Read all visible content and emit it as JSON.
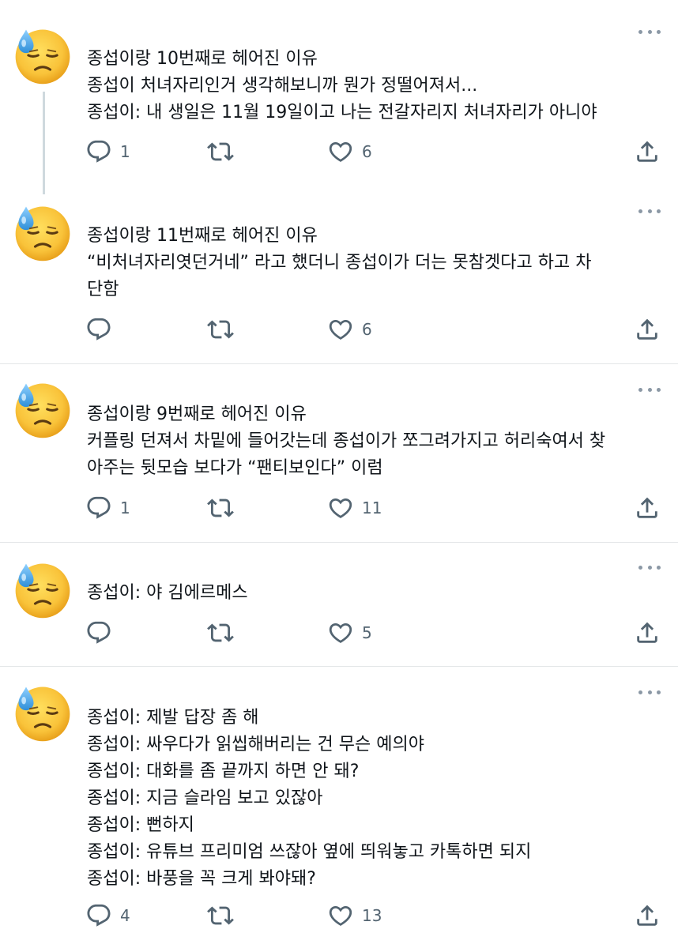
{
  "posts": [
    {
      "lines": [
        "종섭이랑 10번째로 헤어진 이유",
        "종섭이 처녀자리인거 생각해보니까 뭔가 정떨어져서...",
        "종섭이: 내 생일은 11월 19일이고 나는 전갈자리지 처녀자리가 아니야"
      ],
      "reply_count": "1",
      "retweet_count": "",
      "like_count": "6"
    },
    {
      "lines": [
        "종섭이랑 11번째로 헤어진 이유",
        "“비처녀자리엿던거네” 라고 했더니 종섭이가 더는 못참겟다고 하고 차",
        "단함"
      ],
      "reply_count": "",
      "retweet_count": "",
      "like_count": "6"
    },
    {
      "lines": [
        "종섭이랑 9번째로 헤어진 이유",
        "커플링 던져서 차밑에 들어갓는데 종섭이가 쪼그려가지고 허리숙여서 찾",
        "아주는 뒷모습 보다가 “팬티보인다” 이럼"
      ],
      "reply_count": "1",
      "retweet_count": "",
      "like_count": "11"
    },
    {
      "lines": [
        "종섭이: 야 김에르메스"
      ],
      "reply_count": "",
      "retweet_count": "",
      "like_count": "5"
    },
    {
      "lines": [
        "종섭이: 제발 답장 좀 해",
        "종섭이: 싸우다가 읽씹해버리는 건 무슨 예의야",
        "종섭이: 대화를 좀 끝까지 하면 안 돼?",
        "종섭이: 지금 슬라임 보고 있잖아",
        "종섭이: 뻔하지",
        "종섭이: 유튜브 프리미엄 쓰잖아 옆에 띄워놓고 카톡하면 되지",
        "종섭이: 바풍을 꼭 크게 봐야돼?"
      ],
      "reply_count": "4",
      "retweet_count": "",
      "like_count": "13"
    }
  ],
  "icons": {
    "avatar": "downcast-face-with-sweat-emoji",
    "more": "more-horizontal-icon",
    "reply": "reply-icon",
    "retweet": "retweet-icon",
    "like": "heart-icon",
    "share": "share-icon"
  },
  "colors": {
    "text": "#0f1419",
    "icon": "#536471",
    "divider": "#e3e6e8",
    "thread_line": "#cfd9de",
    "emoji_face": "#f7b52c",
    "emoji_sweat": "#5aa9e6"
  }
}
